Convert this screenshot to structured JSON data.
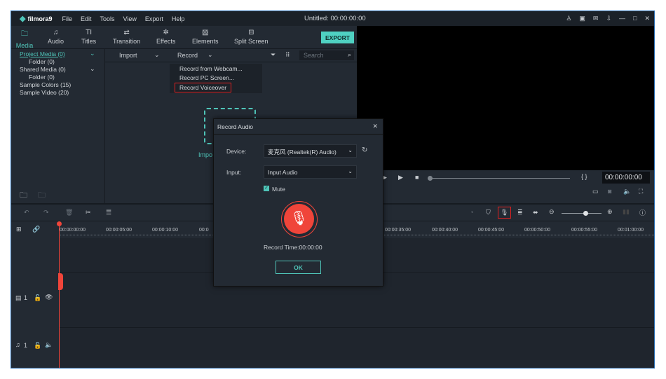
{
  "app": {
    "logo": "filmora9",
    "title": "Untitled: 00:00:00:00",
    "menu": [
      "File",
      "Edit",
      "Tools",
      "View",
      "Export",
      "Help"
    ]
  },
  "tabs": [
    {
      "label": "Media",
      "icon": "folder-icon"
    },
    {
      "label": "Audio",
      "icon": "music-note-icon"
    },
    {
      "label": "Titles",
      "icon": "text-icon"
    },
    {
      "label": "Transition",
      "icon": "transition-icon"
    },
    {
      "label": "Effects",
      "icon": "effects-icon"
    },
    {
      "label": "Elements",
      "icon": "image-icon"
    },
    {
      "label": "Split Screen",
      "icon": "split-screen-icon"
    }
  ],
  "export_label": "EXPORT",
  "sidebar": {
    "items": [
      "Project Media (0)",
      "Folder (0)",
      "Shared Media (0)",
      "Folder (0)",
      "Sample Colors (15)",
      "Sample Video (20)"
    ]
  },
  "media": {
    "import_label": "Import",
    "record_label": "Record",
    "search_placeholder": "Search",
    "import_hint": "Impo"
  },
  "record_menu": [
    "Record from Webcam...",
    "Record PC Screen...",
    "Record Voiceover"
  ],
  "preview": {
    "timecode": "00:00:00:00",
    "brackets": "{  }"
  },
  "ruler": [
    "00:00:00:00",
    "00:00:05:00",
    "00:00:10:00",
    "00:0",
    "00:00:35:00",
    "00:00:40:00",
    "00:00:45:00",
    "00:00:50:00",
    "00:00:55:00",
    "00:01:00:00"
  ],
  "tracks": {
    "video": "1",
    "audio": "1"
  },
  "dialog": {
    "title": "Record Audio",
    "device_label": "Device:",
    "device_value": "麦克风 (Realtek(R) Audio)",
    "input_label": "Input:",
    "input_value": "Input Audio",
    "mute_label": "Mute",
    "mute_checked": true,
    "record_time": "Record Time:00:00:00",
    "ok_label": "OK"
  },
  "colors": {
    "accent": "#4fc4b8",
    "record": "#f0453a",
    "highlight": "#e02020"
  }
}
